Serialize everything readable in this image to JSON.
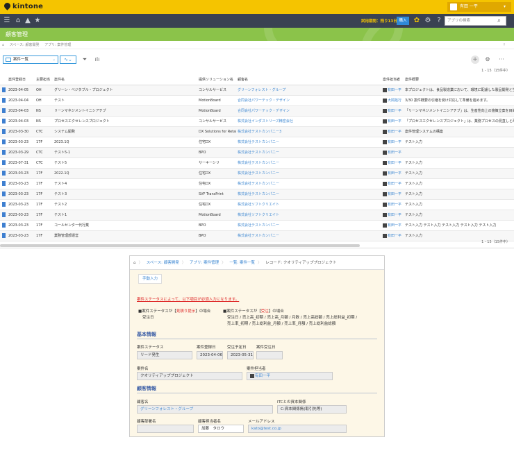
{
  "app": {
    "logo": "kintone",
    "user_name": "有田 一平",
    "trial_text": "試用期間：残り13日",
    "buy_label": "購入",
    "search_placeholder": "アプリの検索",
    "banner_title": "顧客管理",
    "breadcrumbs": [
      "スペース: 顧客開発",
      "アプリ: 案件管理"
    ],
    "view_name": "案件一覧",
    "pager": "1 - 15（15件中）",
    "accent": "#f5c400",
    "banner_color": "#8bc34a",
    "link_color": "#3b86d1"
  },
  "table": {
    "columns": [
      "案件登録日",
      "主要担当",
      "案件名",
      "提供ソリューション名",
      "顧客名",
      "案件担当者",
      "案件概要"
    ],
    "rows": [
      [
        "2023-04-05",
        "OH",
        "グリーン・ベジタブル・プロジェクト",
        "コンサルサービス",
        "グリーンフォレスト・グループ",
        "有田一平",
        "本プロジェクトは、食品製造業において、環境に配慮した製品開発と生産プロ"
      ],
      [
        "2023-04-04",
        "OH",
        "テスト",
        "MotionBoard",
        "合同会社パワーテック・デザイン",
        "大岡拓行",
        "3/30 案件概要の引継を受け対応して準備を進めます。"
      ],
      [
        "2023-04-03",
        "NS",
        "リーンマネジメントイニシアチブ",
        "MotionBoard",
        "合同会社パワーテック・デザイン",
        "有田一平",
        "「リーンマネジメントイニシアチブ」は、生産性向上の施策立案を目的とした"
      ],
      [
        "2023-04-03",
        "NS",
        "プロセスエクセレンスプロジェクト",
        "コンサルサービス",
        "株式会社インダストリーズ精密会社",
        "有田一平",
        "「プロセスエクセレンスプロジェクト」は、業務プロセスの見直しと改善を目"
      ],
      [
        "2023-03-30",
        "CTC",
        "システム開発",
        "DX Solutions for Retail",
        "株式会社テストカンパニー3",
        "有田一平",
        "案件管理システムの構築"
      ],
      [
        "2023-03-23",
        "17F",
        "2023.1Q",
        "住宅DX",
        "株式会社テストカンパニー",
        "有田一平",
        "テスト入力"
      ],
      [
        "2023-03-29",
        "CTC",
        "テスト5-1",
        "BPO",
        "株式会社テストカンパニー",
        "有田一平",
        ""
      ],
      [
        "2023-07-31",
        "CTC",
        "テスト5",
        "サーキーシリ",
        "株式会社テストカンパニー",
        "有田一平",
        "テスト入力"
      ],
      [
        "2023-03-23",
        "17F",
        "2022.1Q",
        "住宅DX",
        "株式会社テストカンパニー",
        "有田一平",
        "テスト入力"
      ],
      [
        "2023-03-23",
        "17F",
        "テスト4",
        "住宅DX",
        "株式会社テストカンパニー",
        "有田一平",
        "テスト入力"
      ],
      [
        "2023-03-23",
        "17F",
        "テスト3",
        "SVF TransPrint",
        "株式会社テストカンパニー",
        "有田一平",
        "テスト入力"
      ],
      [
        "2023-03-23",
        "17F",
        "テスト2",
        "住宅DX",
        "株式会社ソフトクリエイト",
        "有田一平",
        "テスト入力"
      ],
      [
        "2023-03-23",
        "17F",
        "テスト1",
        "MotionBoard",
        "株式会社ソフトクリエイト",
        "有田一平",
        "テスト入力"
      ],
      [
        "2023-03-23",
        "17F",
        "コールセンター代行業",
        "BPO",
        "株式会社テストカンパニー",
        "有田一平",
        "テスト入力 テスト入力 テスト入力 テスト入力 テスト入力"
      ],
      [
        "2023-03-23",
        "17F",
        "業務管理部運営",
        "BPO",
        "株式会社テストカンパニー",
        "有田一平",
        "テスト入力"
      ]
    ]
  },
  "detail": {
    "breadcrumbs": [
      "スペース: 顧客開発",
      "アプリ: 案件管理",
      "一覧: 案件一覧",
      "レコード: クオリティアッププロジェクト"
    ],
    "proxy_label": "手動入力",
    "notice": "案件ステータスによって、以下項目が必須入力になります。",
    "cond1": {
      "pre": "■案件ステータスが【",
      "status": "見積り提示",
      "post": "】の場合",
      "line2": "受注日"
    },
    "cond2": {
      "pre": "■案件ステータスが【",
      "status": "受注",
      "post": "】の場合",
      "line2": "受注日 / 売上高_初期 / 売上高_月額 / 月数 / 売上高総額 / 売上総利益_初期 /",
      "line3": "売上率_初期 / 売上総利益_月額 / 売上率_月額 / 売上総利益総額"
    },
    "basic_title": "基本情報",
    "status_label": "案件ステータス",
    "status_value": "リード発生",
    "reg_date_label": "案件登録日",
    "reg_date_value": "2023-04-06",
    "order_plan_label": "受注予定日",
    "order_plan_value": "2023-05-31",
    "order_date_label": "案件受注日",
    "order_date_value": "",
    "name_label": "案件名",
    "name_value": "クオリティアッププロジェクト",
    "owner_label": "案件担当者",
    "owner_value": "有田一平",
    "customer_title": "顧客情報",
    "cust_name_label": "顧客名",
    "cust_name_value": "グリーンフォレスト・グループ",
    "itc_label": "ITCとの資本関係",
    "itc_value": "C:資本関係無(取引先等)",
    "dept_label": "顧客部署名",
    "dept_value": "",
    "contact_label": "顧客担当者名",
    "contact_value": "加藤　タロウ",
    "mail_label": "メールアドレス",
    "mail_value": "kato@test.co.jp"
  }
}
